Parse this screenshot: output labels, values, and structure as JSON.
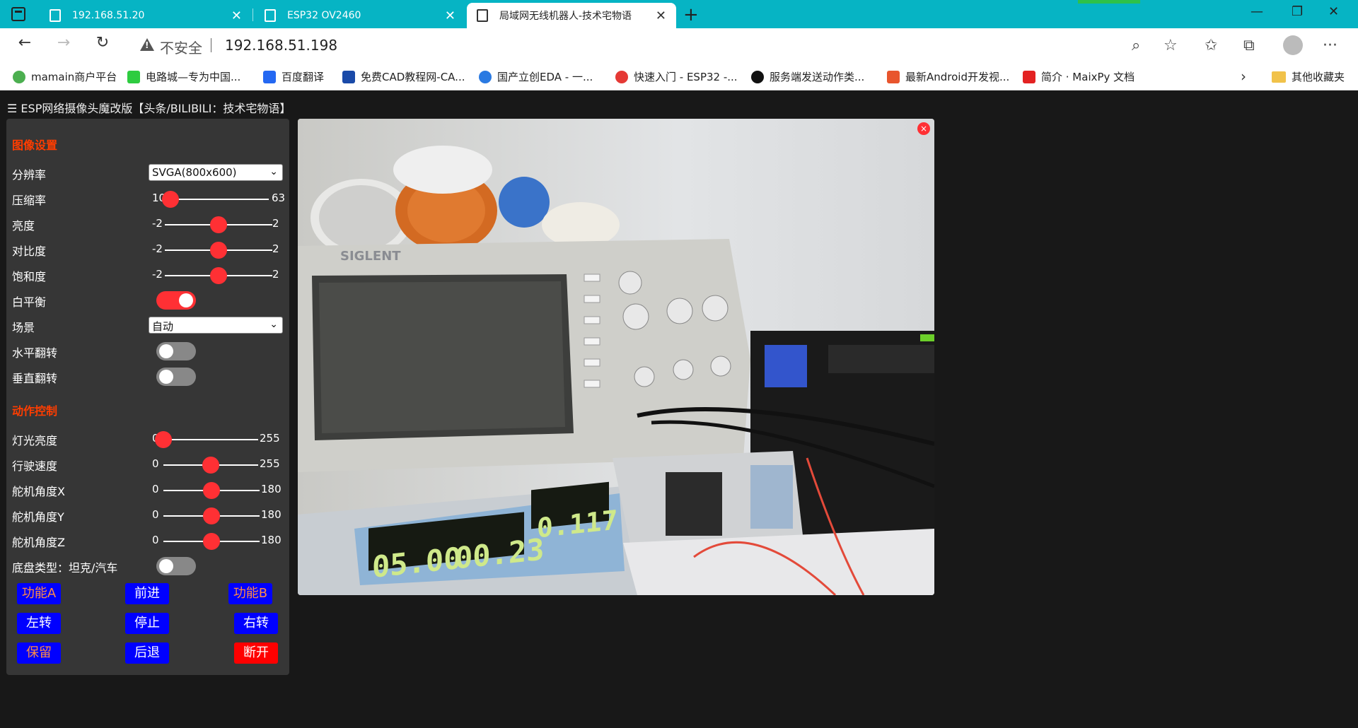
{
  "browser": {
    "tabs": [
      {
        "title": "192.168.51.20",
        "active": false
      },
      {
        "title": "ESP32 OV2460",
        "active": false
      },
      {
        "title": "局域网无线机器人-技术宅物语",
        "active": true
      }
    ],
    "close_symbol": "✕",
    "new_tab_symbol": "+",
    "window_controls": {
      "minimize": "—",
      "restore": "❐",
      "close": "✕"
    },
    "nav": {
      "back": "←",
      "forward": "→",
      "reload": "↻"
    },
    "security_label": "不安全",
    "url": "192.168.51.198",
    "toolbar_icons": {
      "zoom": "⌕",
      "favorite": "☆",
      "favorites_list": "✩",
      "collections": "⧉",
      "menu": "···"
    },
    "bookmarks": [
      {
        "label": "mamain商户平台",
        "color": "#4caf50"
      },
      {
        "label": "电路城—专为中国...",
        "color": "#2ecc40"
      },
      {
        "label": "百度翻译",
        "color": "#2468f2"
      },
      {
        "label": "免费CAD教程网-CA...",
        "color": "#1a4aa8"
      },
      {
        "label": "国产立创EDA - 一...",
        "color": "#2a7ae2"
      },
      {
        "label": "快速入门 - ESP32 -...",
        "color": "#e53935"
      },
      {
        "label": "服务端发送动作类...",
        "color": "#111111"
      },
      {
        "label": "最新Android开发视...",
        "color": "#e8552d"
      },
      {
        "label": "简介 · MaixPy 文档",
        "color": "#e32222"
      }
    ],
    "more_bookmarks_symbol": "›",
    "other_bookmarks": "其他收藏夹"
  },
  "page": {
    "title": "☰ ESP网络摄像头魔改版【头条/BILIBILI：技术宅物语】"
  },
  "image_settings": {
    "heading": "图像设置",
    "resolution": {
      "label": "分辨率",
      "value": "SVGA(800x600)"
    },
    "quality": {
      "label": "压缩率",
      "min": "10",
      "max": "63",
      "value": 10,
      "lo": 10,
      "hi": 63
    },
    "brightness": {
      "label": "亮度",
      "min": "-2",
      "max": "2",
      "value": 0,
      "lo": -2,
      "hi": 2
    },
    "contrast": {
      "label": "对比度",
      "min": "-2",
      "max": "2",
      "value": 0,
      "lo": -2,
      "hi": 2
    },
    "saturation": {
      "label": "饱和度",
      "min": "-2",
      "max": "2",
      "value": 0,
      "lo": -2,
      "hi": 2
    },
    "awb": {
      "label": "白平衡",
      "on": true
    },
    "scene": {
      "label": "场景",
      "value": "自动"
    },
    "hmirror": {
      "label": "水平翻转",
      "on": false
    },
    "vflip": {
      "label": "垂直翻转",
      "on": false
    }
  },
  "motion_control": {
    "heading": "动作控制",
    "light": {
      "label": "灯光亮度",
      "min": "0",
      "max": "255",
      "value": 0,
      "lo": 0,
      "hi": 255
    },
    "speed": {
      "label": "行驶速度",
      "min": "0",
      "max": "255",
      "value": 128,
      "lo": 0,
      "hi": 255
    },
    "servo_x": {
      "label": "舵机角度X",
      "min": "0",
      "max": "180",
      "value": 90,
      "lo": 0,
      "hi": 180
    },
    "servo_y": {
      "label": "舵机角度Y",
      "min": "0",
      "max": "180",
      "value": 90,
      "lo": 0,
      "hi": 180
    },
    "servo_z": {
      "label": "舵机角度Z",
      "min": "0",
      "max": "180",
      "value": 90,
      "lo": 0,
      "hi": 180
    },
    "chassis": {
      "label": "底盘类型：坦克/汽车",
      "on": false
    },
    "buttons": {
      "func_a": "功能A",
      "forward": "前进",
      "func_b": "功能B",
      "left": "左转",
      "stop": "停止",
      "right": "右转",
      "reserve": "保留",
      "backward": "后退",
      "disconnect": "断开"
    }
  },
  "stream": {
    "close_symbol": "×",
    "scope_brand": "SIGLENT",
    "psu_voltage": "05.00",
    "psu_current": "00.23",
    "meter_reading": "0.117"
  },
  "colors": {
    "accent_red": "#ff3034",
    "heading_orange": "#ff3d00",
    "button_blue": "#0000ff",
    "tab_bar": "#06b4c4"
  }
}
